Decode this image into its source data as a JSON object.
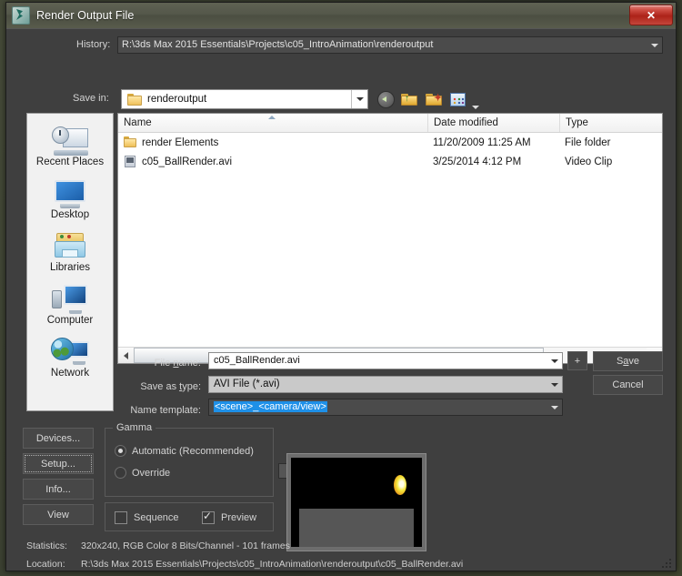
{
  "window": {
    "title": "Render Output File",
    "app_icon": "3dsmax-icon",
    "close_label": "✕"
  },
  "history": {
    "label": "History:",
    "value": "R:\\3ds Max 2015 Essentials\\Projects\\c05_IntroAnimation\\renderoutput"
  },
  "save_in": {
    "label": "Save in:",
    "value": "renderoutput"
  },
  "toolbar": {
    "back": "back-icon",
    "up": "up-one-level-icon",
    "new_folder": "new-folder-icon",
    "views": "views-icon"
  },
  "places": {
    "items": [
      {
        "label": "Recent Places",
        "icon": "recent-places-icon"
      },
      {
        "label": "Desktop",
        "icon": "desktop-icon"
      },
      {
        "label": "Libraries",
        "icon": "libraries-icon"
      },
      {
        "label": "Computer",
        "icon": "computer-icon"
      },
      {
        "label": "Network",
        "icon": "network-icon"
      }
    ]
  },
  "file_list": {
    "columns": [
      "Name",
      "Date modified",
      "Type"
    ],
    "sort_column": "Name",
    "rows": [
      {
        "icon": "folder-icon",
        "name": "render Elements",
        "date_modified": "11/20/2009 11:25 AM",
        "type": "File folder"
      },
      {
        "icon": "video-file-icon",
        "name": "c05_BallRender.avi",
        "date_modified": "3/25/2014 4:12 PM",
        "type": "Video Clip"
      }
    ]
  },
  "form": {
    "file_name_label": "File name:",
    "file_name_accel": "n",
    "file_name_value": "c05_BallRender.avi",
    "save_as_type_label": "Save as type:",
    "save_as_type_accel": "t",
    "save_as_type_value": "AVI File (*.avi)",
    "name_template_label": "Name template:",
    "name_template_value": "<scene>_<camera/view>",
    "plus_button": "+",
    "save_button": "Save",
    "save_accel": "S",
    "cancel_button": "Cancel"
  },
  "side_buttons": [
    {
      "label": "Devices...",
      "focused": false
    },
    {
      "label": "Setup...",
      "focused": true
    },
    {
      "label": "Info...",
      "focused": false
    },
    {
      "label": "View",
      "focused": false
    }
  ],
  "gamma": {
    "title": "Gamma",
    "automatic_label": "Automatic (Recommended)",
    "automatic_selected": true,
    "override_label": "Override",
    "override_selected": false,
    "override_value": ""
  },
  "options": {
    "sequence_label": "Sequence",
    "sequence_checked": false,
    "preview_label": "Preview",
    "preview_checked": true
  },
  "preview": {
    "name": "render-preview-thumbnail"
  },
  "status": {
    "statistics_label": "Statistics:",
    "statistics_value": "320x240, RGB Color 8 Bits/Channel - 101 frames",
    "location_label": "Location:",
    "location_value": "R:\\3ds Max 2015 Essentials\\Projects\\c05_IntroAnimation\\renderoutput\\c05_BallRender.avi"
  },
  "colors": {
    "dialog_bg": "#3f3f3f",
    "titlebar": "#54574a",
    "close_red": "#ad2318",
    "selection_blue": "#1e90e8",
    "desktop_bg": "#3a3f30"
  }
}
